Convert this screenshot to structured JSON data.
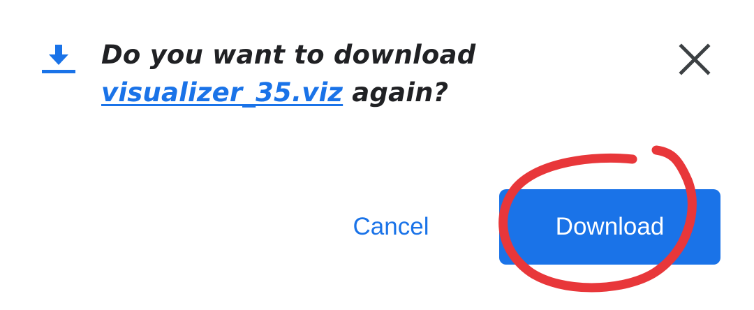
{
  "dialog": {
    "icon": "download-arrow-icon",
    "message_before": "Do you want to download ",
    "file_name": "visualizer_35.viz",
    "message_after": " again?",
    "close_icon": "close-icon"
  },
  "actions": {
    "cancel_label": "Cancel",
    "download_label": "Download"
  },
  "colors": {
    "accent": "#1a73e8",
    "text": "#202124",
    "annotation": "#e8373a"
  }
}
